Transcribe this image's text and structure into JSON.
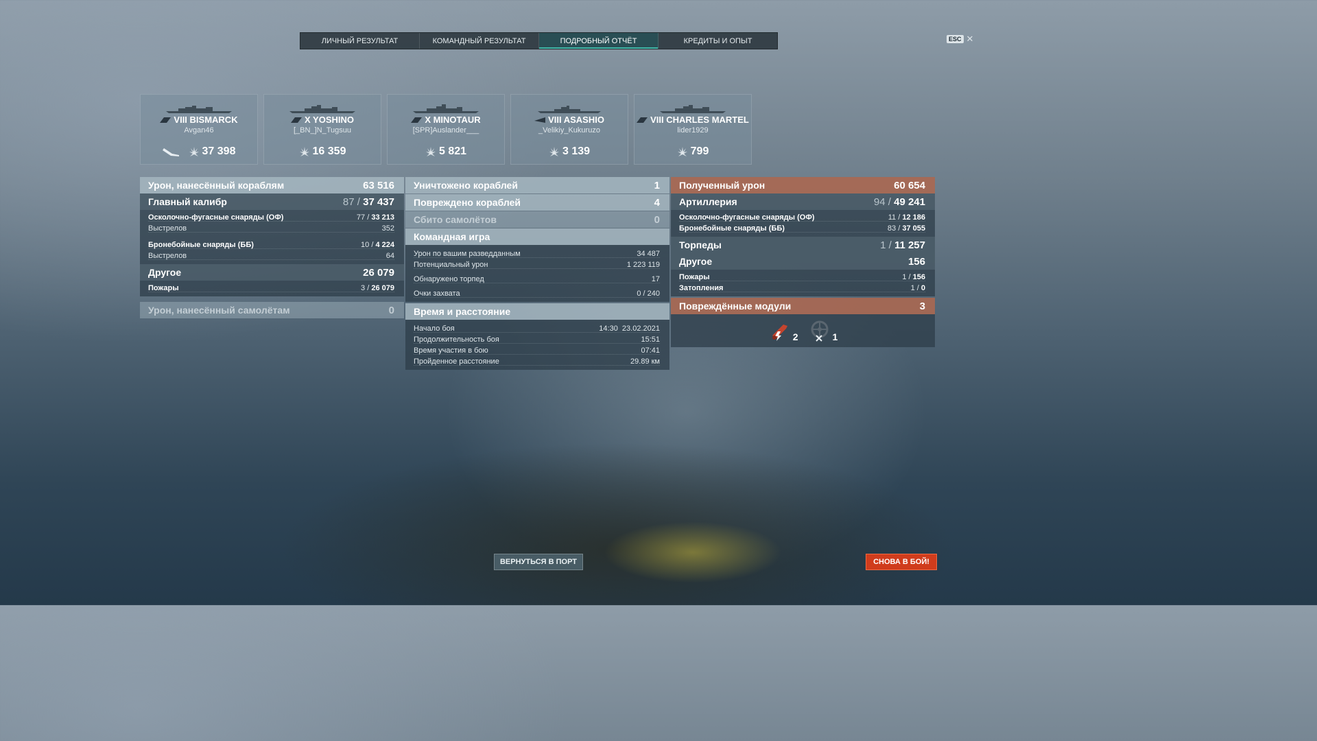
{
  "tabs": [
    {
      "label": "ЛИЧНЫЙ РЕЗУЛЬТАТ"
    },
    {
      "label": "КОМАНДНЫЙ РЕЗУЛЬТАТ"
    },
    {
      "label": "ПОДРОБНЫЙ ОТЧЁТ",
      "active": true
    },
    {
      "label": "КРЕДИТЫ И ОПЫТ"
    }
  ],
  "esc": {
    "key": "ESC",
    "close": "✕"
  },
  "ships": [
    {
      "tier_name": "VIII BISMARCK",
      "player": "Avgan46",
      "damage": "37 398",
      "class_icon": "battleship-icon"
    },
    {
      "tier_name": "X YOSHINO",
      "player": "[_BN_]N_Tugsuu",
      "damage": "16 359",
      "class_icon": "cruiser-icon"
    },
    {
      "tier_name": "X MINOTAUR",
      "player": "[SPR]Auslander___",
      "damage": "5 821",
      "class_icon": "cruiser-icon"
    },
    {
      "tier_name": "VIII ASASHIO",
      "player": "_Velikiy_Kukuruzo",
      "damage": "3 139",
      "class_icon": "destroyer-icon"
    },
    {
      "tier_name": "VIII CHARLES MARTEL",
      "player": "lider1929",
      "damage": "799",
      "class_icon": "cruiser-icon"
    }
  ],
  "left": {
    "ship_damage": {
      "label": "Урон, нанесённый кораблям",
      "value": "63 516"
    },
    "main_battery": {
      "label": "Главный калибр",
      "hits": "87",
      "value": "37 437"
    },
    "he": {
      "label": "Осколочно-фугасные снаряды (ОФ)",
      "hits": "77",
      "value": "33 213"
    },
    "he_shots": {
      "label": "Выстрелов",
      "value": "352"
    },
    "ap": {
      "label": "Бронебойные снаряды (ББ)",
      "hits": "10",
      "value": "4 224"
    },
    "ap_shots": {
      "label": "Выстрелов",
      "value": "64"
    },
    "other": {
      "label": "Другое",
      "value": "26 079"
    },
    "fires": {
      "label": "Пожары",
      "hits": "3",
      "value": "26 079"
    },
    "plane_damage": {
      "label": "Урон, нанесённый самолётам",
      "value": "0"
    }
  },
  "middle": {
    "destroyed": {
      "label": "Уничтожено кораблей",
      "value": "1"
    },
    "damaged": {
      "label": "Повреждено кораблей",
      "value": "4"
    },
    "planes": {
      "label": "Сбито самолётов",
      "value": "0"
    },
    "team": {
      "label": "Командная игра",
      "spot_damage": {
        "label": "Урон по вашим разведданным",
        "value": "34 487"
      },
      "potential": {
        "label": "Потенциальный урон",
        "value": "1 223 119"
      },
      "torps_spotted": {
        "label": "Обнаружено торпед",
        "value": "17"
      },
      "capture": {
        "label": "Очки захвата",
        "value": "0 / 240"
      }
    },
    "time": {
      "label": "Время и расстояние",
      "start": {
        "label": "Начало боя",
        "value": "14:30  23.02.2021"
      },
      "duration": {
        "label": "Продолжительность боя",
        "value": "15:51"
      },
      "participation": {
        "label": "Время участия в бою",
        "value": "07:41"
      },
      "distance": {
        "label": "Пройденное расстояние",
        "value": "29.89 км"
      }
    }
  },
  "right": {
    "received": {
      "label": "Полученный урон",
      "value": "60 654"
    },
    "artillery": {
      "label": "Артиллерия",
      "hits": "94",
      "value": "49 241"
    },
    "he": {
      "label": "Осколочно-фугасные снаряды (ОФ)",
      "hits": "11",
      "value": "12 186"
    },
    "ap": {
      "label": "Бронебойные снаряды (ББ)",
      "hits": "83",
      "value": "37 055"
    },
    "torpedoes": {
      "label": "Торпеды",
      "hits": "1",
      "value": "11 257"
    },
    "other": {
      "label": "Другое",
      "value": "156"
    },
    "fires": {
      "label": "Пожары",
      "hits": "1",
      "value": "156"
    },
    "flooding": {
      "label": "Затопления",
      "hits": "1",
      "value": "0"
    },
    "modules": {
      "label": "Повреждённые модули",
      "value": "3",
      "items": [
        {
          "icon": "gun-damage-icon",
          "count": "2"
        },
        {
          "icon": "steering-damage-icon",
          "count": "1"
        }
      ]
    }
  },
  "buttons": {
    "port": "ВЕРНУТЬСЯ В ПОРТ",
    "battle": "СНОВА В БОЙ!"
  }
}
